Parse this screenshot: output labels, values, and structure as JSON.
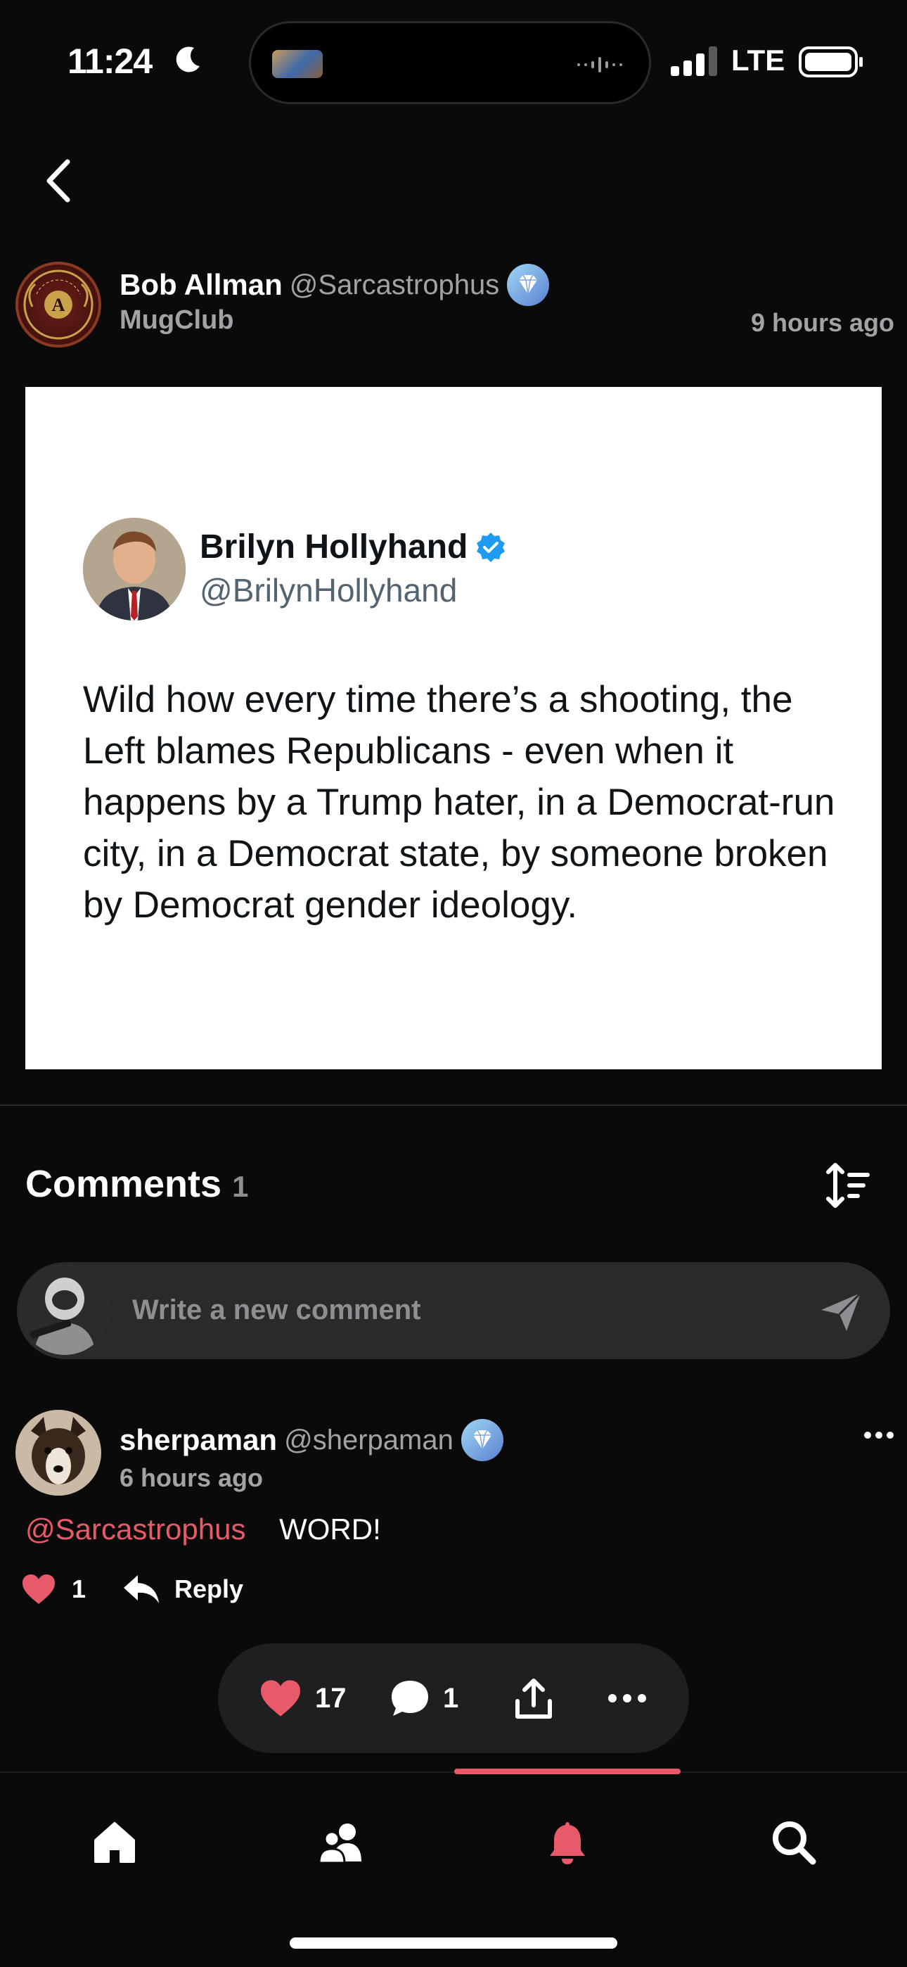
{
  "status_bar": {
    "time": "11:24",
    "network": "LTE"
  },
  "post": {
    "author_name": "Bob Allman",
    "author_handle": "@Sarcastrophus",
    "group": "MugClub",
    "time_ago": "9 hours ago",
    "avatar_badge_text": "ASSHOLE MERIT BADGE"
  },
  "embedded_tweet": {
    "name": "Brilyn Hollyhand",
    "handle": "@BrilynHollyhand",
    "text": "Wild how every time there’s a shooting, the Left blames Republicans - even when it happens by a Trump hater, in a Democrat-run city, in a Democrat state, by someone broken by Democrat gender ideology."
  },
  "comments_section": {
    "title": "Comments",
    "count": "1",
    "input_placeholder": "Write a new comment"
  },
  "comments": [
    {
      "name": "sherpaman",
      "handle": "@sherpaman",
      "time_ago": "6 hours ago",
      "mention": "@Sarcastrophus",
      "body": "WORD!",
      "likes": "1",
      "reply_label": "Reply"
    }
  ],
  "action_bar": {
    "likes": "17",
    "comments": "1"
  },
  "tab_bar": {
    "tabs": [
      "home-icon",
      "people-icon",
      "bell-icon",
      "search-icon"
    ],
    "active_index": 2
  },
  "colors": {
    "background": "#0a0a0b",
    "accent": "#e85a6a",
    "muted_text": "#a2a2a7",
    "verified_blue": "#1d9bf0"
  }
}
